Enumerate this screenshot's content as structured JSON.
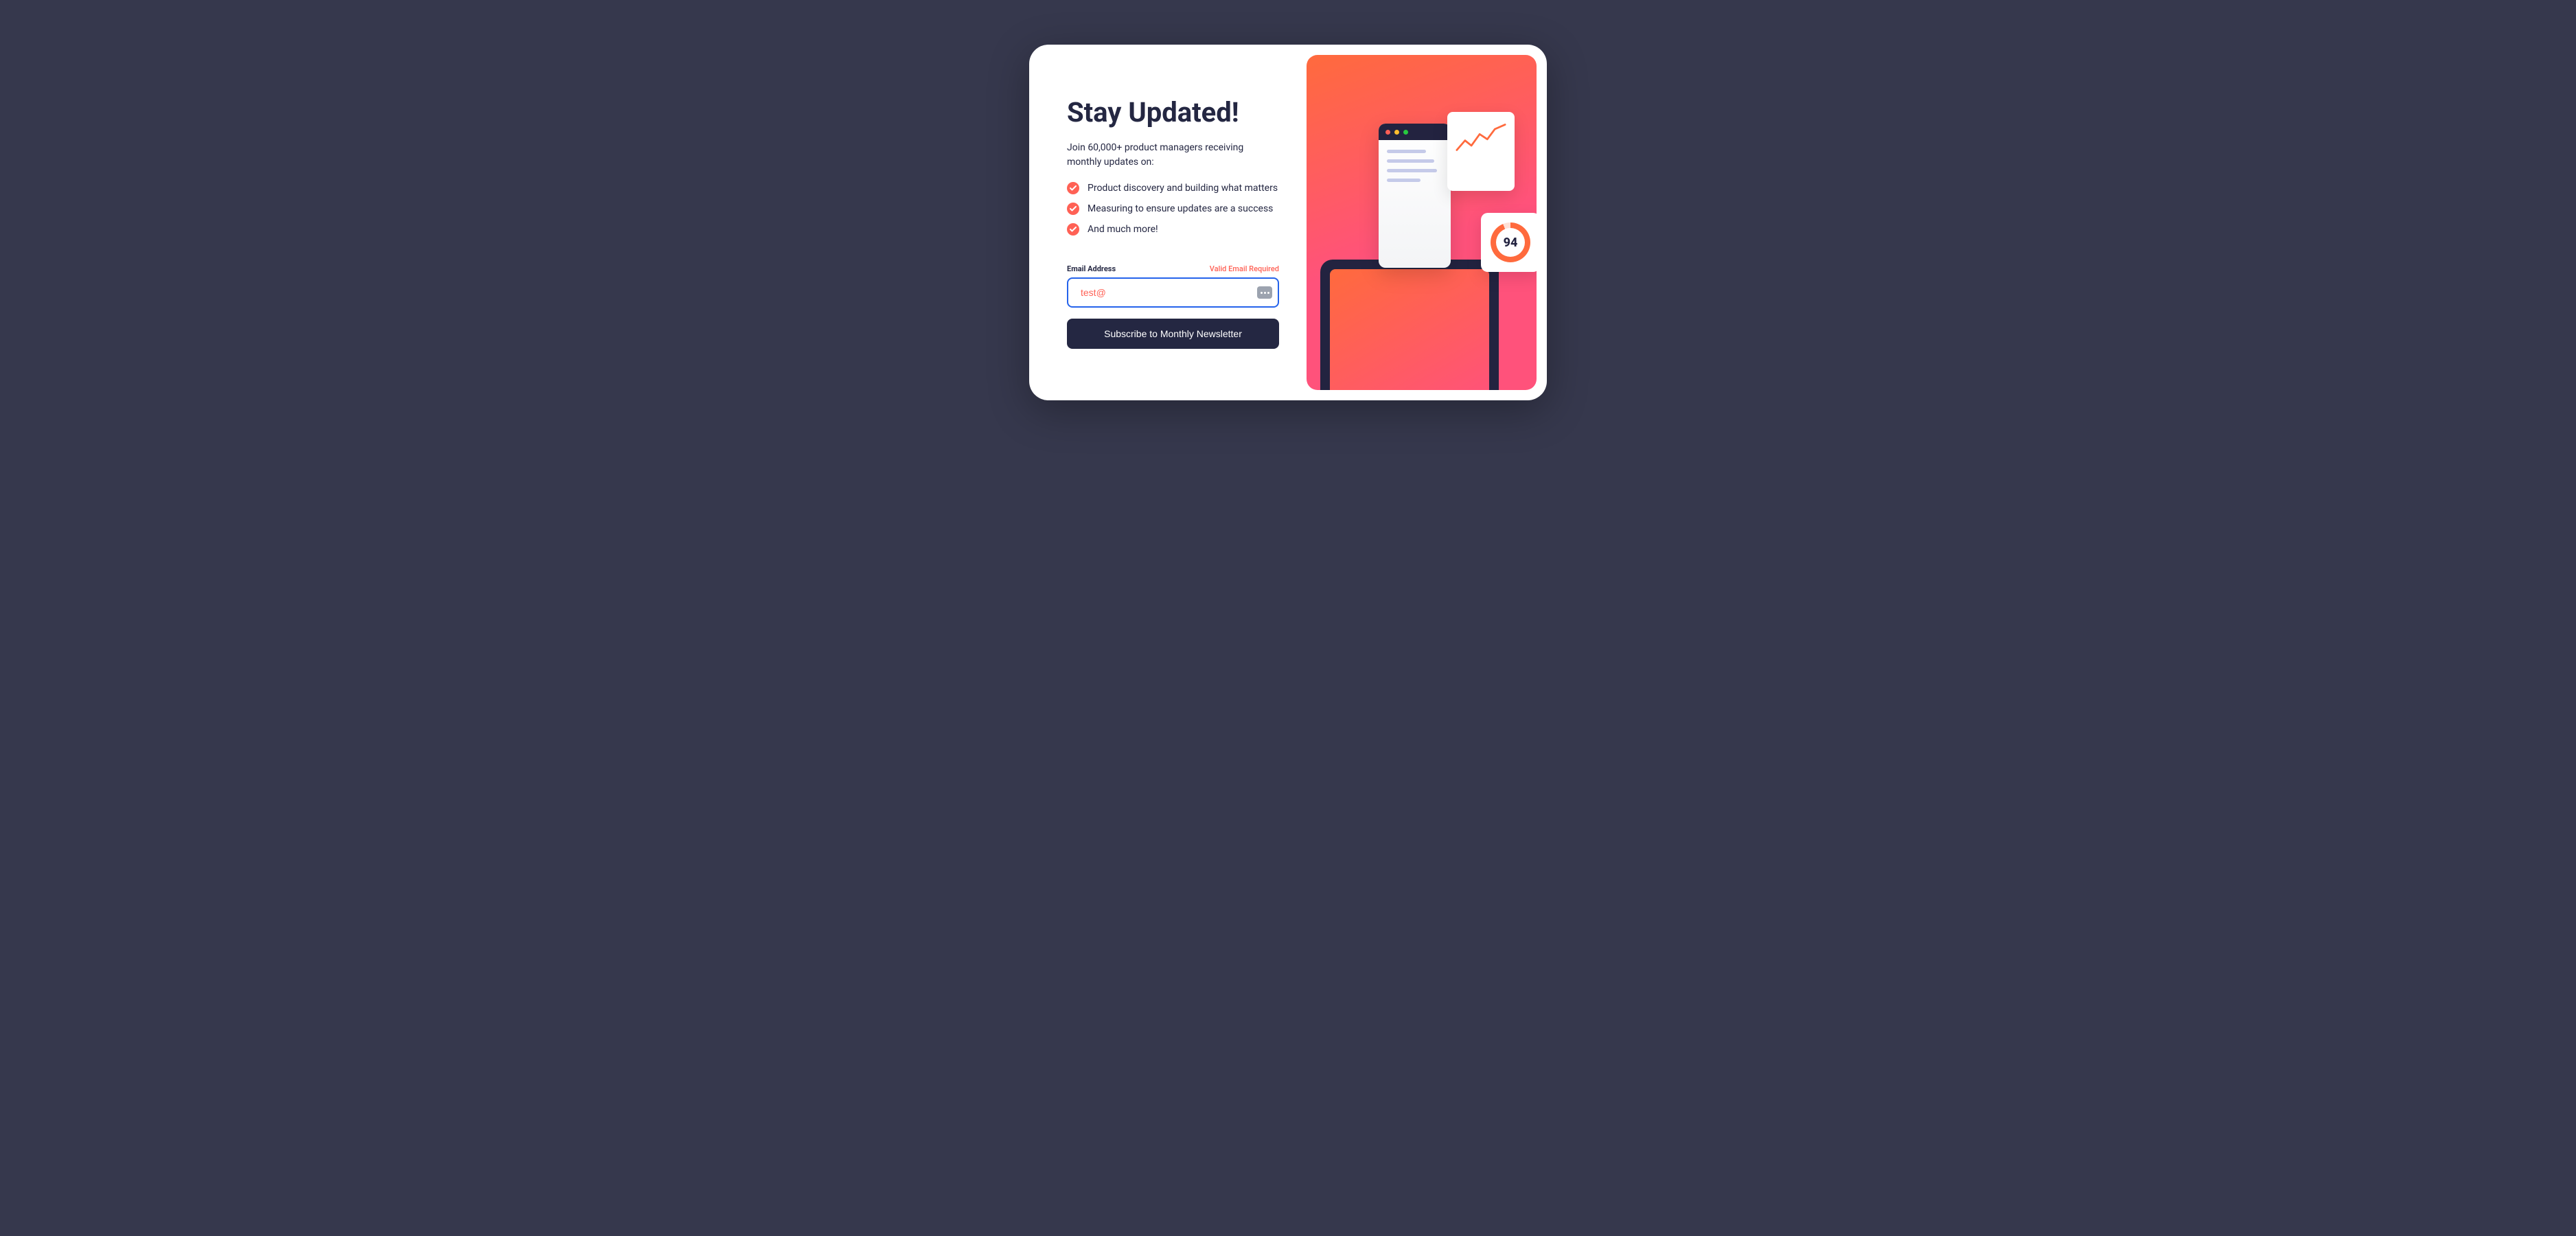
{
  "card": {
    "title": "Stay Updated!",
    "subtitle": "Join 60,000+ product managers receiving monthly updates on:",
    "features": [
      "Product discovery and building what matters",
      "Measuring to ensure updates are a success",
      "And much more!"
    ],
    "form": {
      "label": "Email Address",
      "error": "Valid Email Required",
      "value": "test@",
      "button": "Subscribe to Monthly Newsletter"
    }
  },
  "illustration": {
    "score": "94"
  }
}
